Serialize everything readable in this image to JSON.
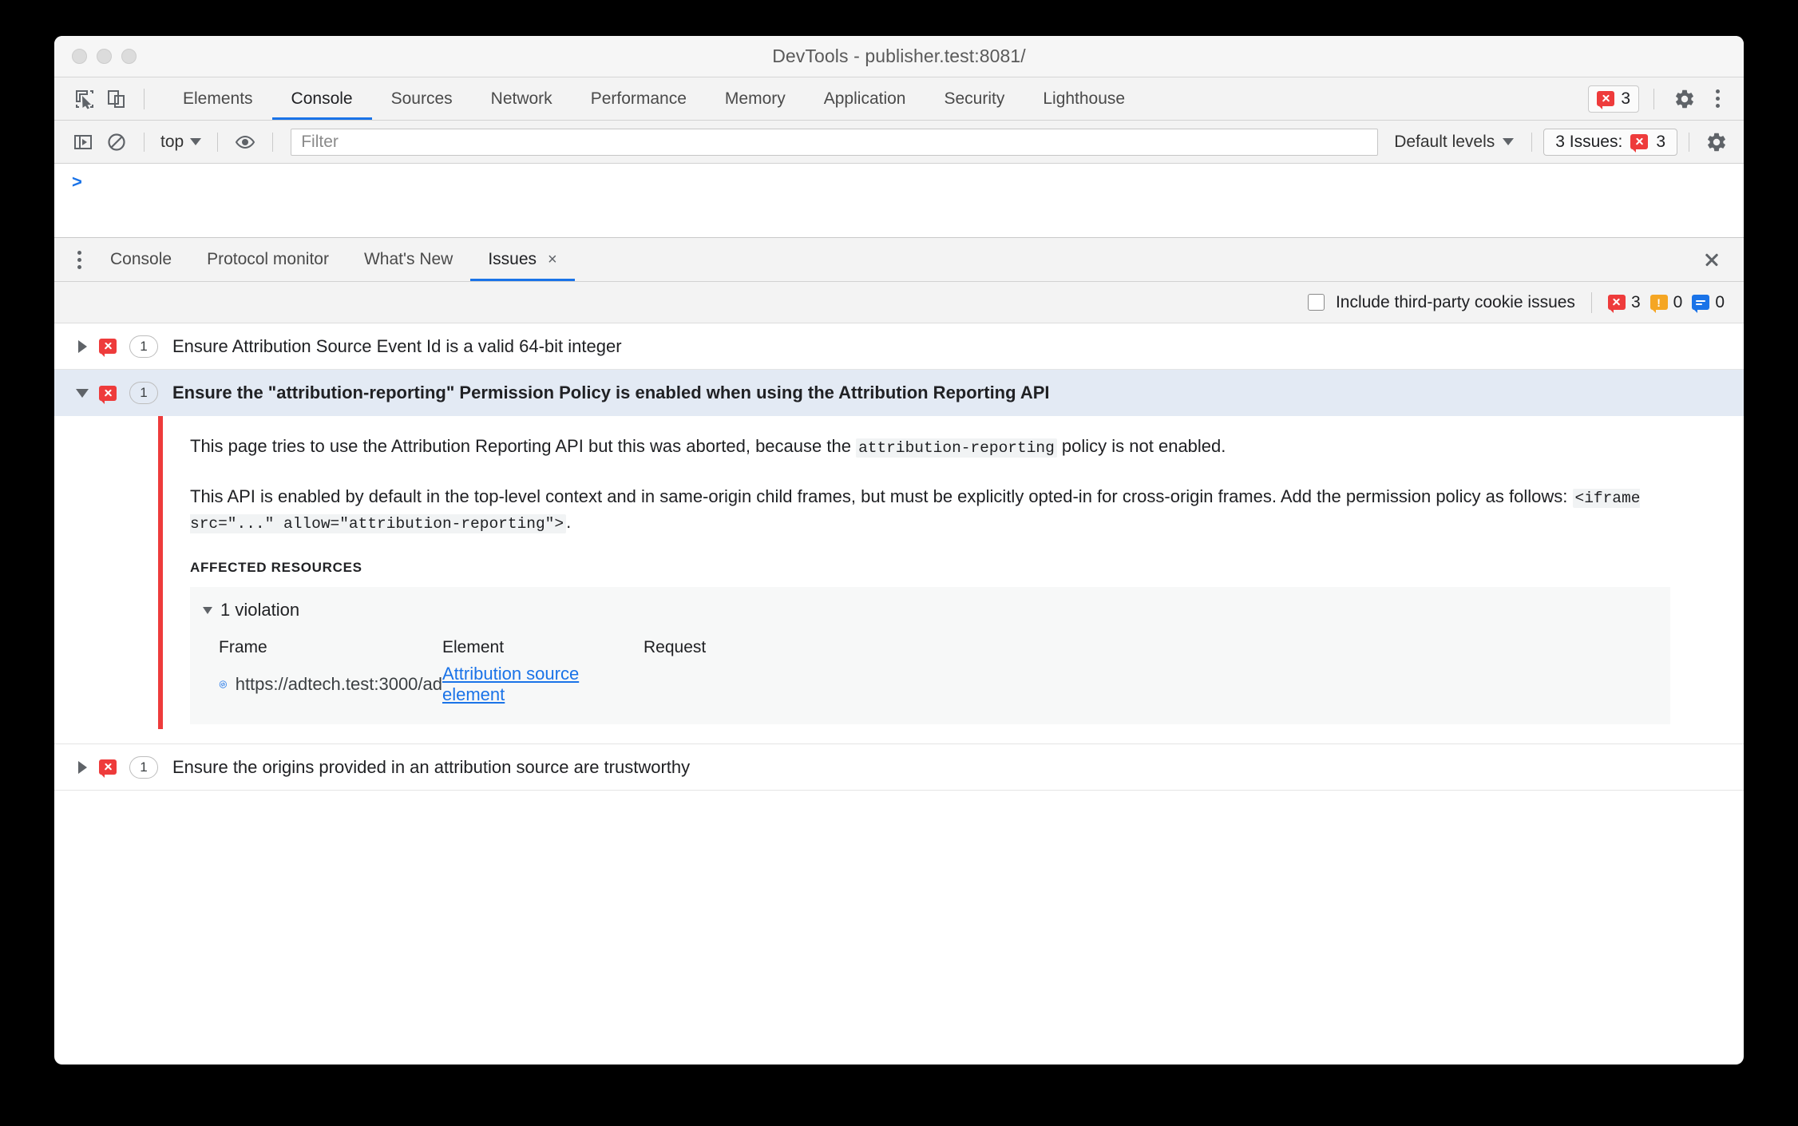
{
  "window": {
    "title": "DevTools - publisher.test:8081/",
    "traffic_lights": [
      "close",
      "minimize",
      "maximize"
    ]
  },
  "tabbar": {
    "inspect_icon": "inspect-cursor-icon",
    "device_icon": "device-toolbar-icon",
    "tabs": [
      {
        "label": "Elements",
        "active": false
      },
      {
        "label": "Console",
        "active": true
      },
      {
        "label": "Sources",
        "active": false
      },
      {
        "label": "Network",
        "active": false
      },
      {
        "label": "Performance",
        "active": false
      },
      {
        "label": "Memory",
        "active": false
      },
      {
        "label": "Application",
        "active": false
      },
      {
        "label": "Security",
        "active": false
      },
      {
        "label": "Lighthouse",
        "active": false
      }
    ],
    "error_chip": {
      "count": "3",
      "icon": "error-bubble-icon"
    },
    "settings_icon": "gear-icon",
    "more_icon": "kebab-menu-icon"
  },
  "console_toolbar": {
    "sidebar_toggle_icon": "console-sidebar-icon",
    "clear_icon": "clear-console-icon",
    "context": "top",
    "eye_icon": "live-expression-icon",
    "filter_placeholder": "Filter",
    "filter_value": "",
    "levels": "Default levels",
    "issues_button": {
      "label": "3 Issues:",
      "count": "3"
    },
    "settings_icon": "gear-icon"
  },
  "console": {
    "prompt": ">"
  },
  "drawer": {
    "more_icon": "kebab-menu-icon",
    "tabs": [
      {
        "label": "Console",
        "active": false,
        "closable": false
      },
      {
        "label": "Protocol monitor",
        "active": false,
        "closable": false
      },
      {
        "label": "What's New",
        "active": false,
        "closable": false
      },
      {
        "label": "Issues",
        "active": true,
        "closable": true,
        "close_glyph": "×"
      }
    ],
    "close_icon": "close-drawer-icon"
  },
  "issues_toolbar": {
    "third_party_label": "Include third-party cookie issues",
    "third_party_checked": false,
    "errors": "3",
    "warnings": "0",
    "infos": "0"
  },
  "issues": [
    {
      "severity": "error",
      "count": "1",
      "title": "Ensure Attribution Source Event Id is a valid 64-bit integer",
      "expanded": false
    },
    {
      "severity": "error",
      "count": "1",
      "title": "Ensure the \"attribution-reporting\" Permission Policy is enabled when using the Attribution Reporting API",
      "expanded": true,
      "detail": {
        "paragraph1_a": "This page tries to use the Attribution Reporting API but this was aborted, because the ",
        "paragraph1_code": "attribution-reporting",
        "paragraph1_b": " policy is not enabled.",
        "paragraph2_a": "This API is enabled by default in the top-level context and in same-origin child frames, but must be explicitly opted-in for cross-origin frames. Add the permission policy as follows: ",
        "paragraph2_code": "<iframe src=\"...\" allow=\"attribution-reporting\">",
        "paragraph2_b": ".",
        "affected_label": "AFFECTED RESOURCES",
        "violation_summary": "1 violation",
        "columns": [
          "Frame",
          "Element",
          "Request"
        ],
        "rows": [
          {
            "frame_icon": "source-code-icon",
            "frame": "https://adtech.test:3000/ad",
            "element": "Attribution source element",
            "request": ""
          }
        ]
      }
    },
    {
      "severity": "error",
      "count": "1",
      "title": "Ensure the origins provided in an attribution source are trustworthy",
      "expanded": false
    }
  ],
  "colors": {
    "accent": "#1a73e8",
    "error": "#ee3b3b",
    "warning": "#f5a623",
    "selected_row": "#e3eaf4"
  }
}
